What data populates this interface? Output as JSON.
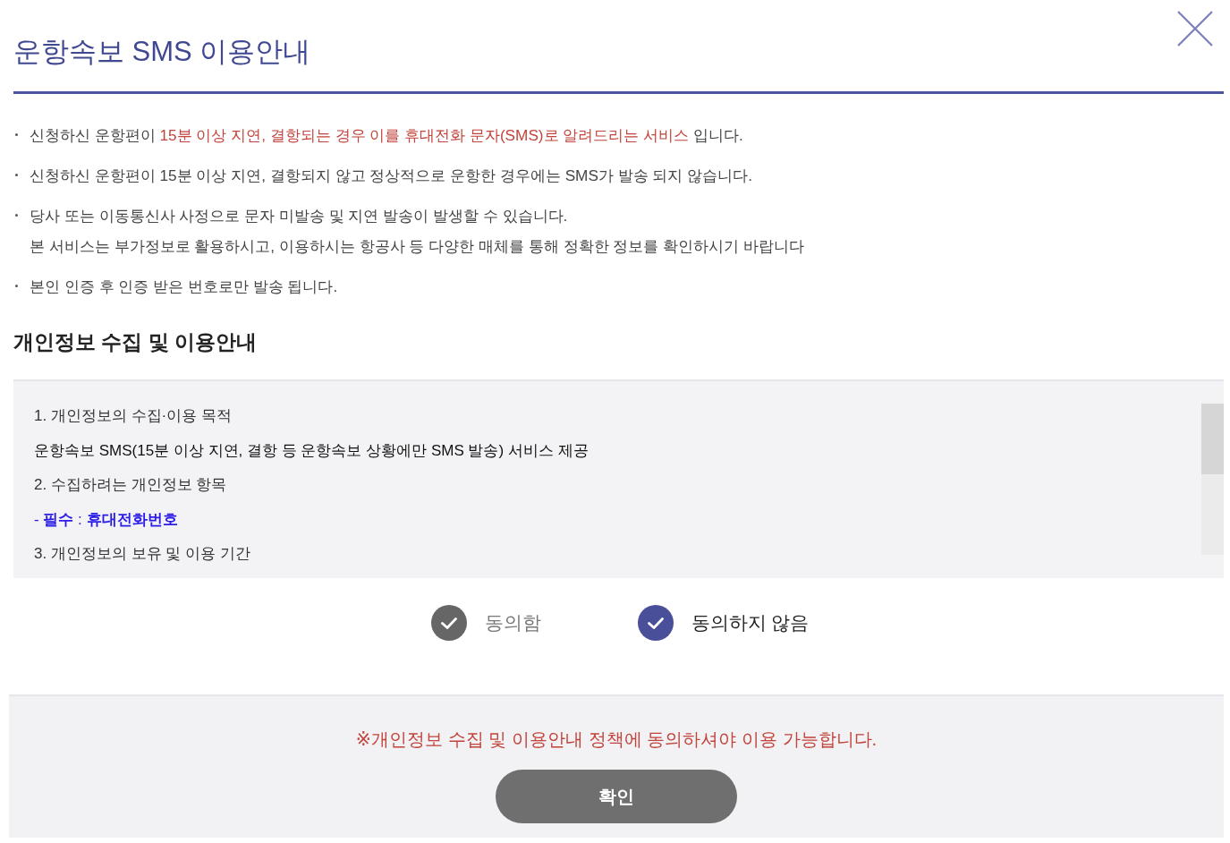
{
  "dialog": {
    "title": "운항속보 SMS 이용안내"
  },
  "notices": [
    {
      "lines": [
        [
          {
            "text": "신청하신 운항편이 ",
            "highlight": false
          },
          {
            "text": "15분 이상 지연, 결항되는 경우 이를 휴대전화 문자(SMS)로 알려드리는 서비스",
            "highlight": true
          },
          {
            "text": " 입니다.",
            "highlight": false
          }
        ]
      ]
    },
    {
      "lines": [
        [
          {
            "text": "신청하신 운항편이 15분 이상 지연, 결항되지 않고 정상적으로 운항한 경우에는 SMS가 발송 되지 않습니다.",
            "highlight": false
          }
        ]
      ]
    },
    {
      "lines": [
        [
          {
            "text": "당사 또는 이동통신사 사정으로 문자 미발송 및 지연 발송이 발생할 수 있습니다.",
            "highlight": false
          }
        ],
        [
          {
            "text": "본 서비스는 부가정보로 활용하시고, 이용하시는 항공사 등 다양한 매체를 통해 정확한 정보를 확인하시기 바랍니다",
            "highlight": false
          }
        ]
      ]
    },
    {
      "lines": [
        [
          {
            "text": "본인 인증 후 인증 받은 번호로만 발송 됩니다.",
            "highlight": false
          }
        ]
      ]
    }
  ],
  "privacy": {
    "heading": "개인정보 수집 및 이용안내",
    "lines": [
      {
        "kind": "heading",
        "text": "1. 개인정보의 수집·이용 목적"
      },
      {
        "kind": "body",
        "text": "운항속보 SMS(15분 이상 지연, 결항 등 운항속보 상황에만 SMS 발송) 서비스 제공"
      },
      {
        "kind": "heading",
        "text": "2. 수집하려는 개인정보 항목"
      },
      {
        "kind": "required",
        "text": "- **필수** : **휴대전화번호**"
      },
      {
        "kind": "heading",
        "text": "3. 개인정보의 보유 및 이용 기간"
      }
    ]
  },
  "consent": {
    "options": [
      {
        "label": "동의함",
        "selected": false
      },
      {
        "label": "동의하지 않음",
        "selected": true
      }
    ]
  },
  "footer": {
    "notice": "※개인정보 수집 및 이용안내 정책에 동의하셔야 이용 가능합니다.",
    "button": "확인"
  }
}
